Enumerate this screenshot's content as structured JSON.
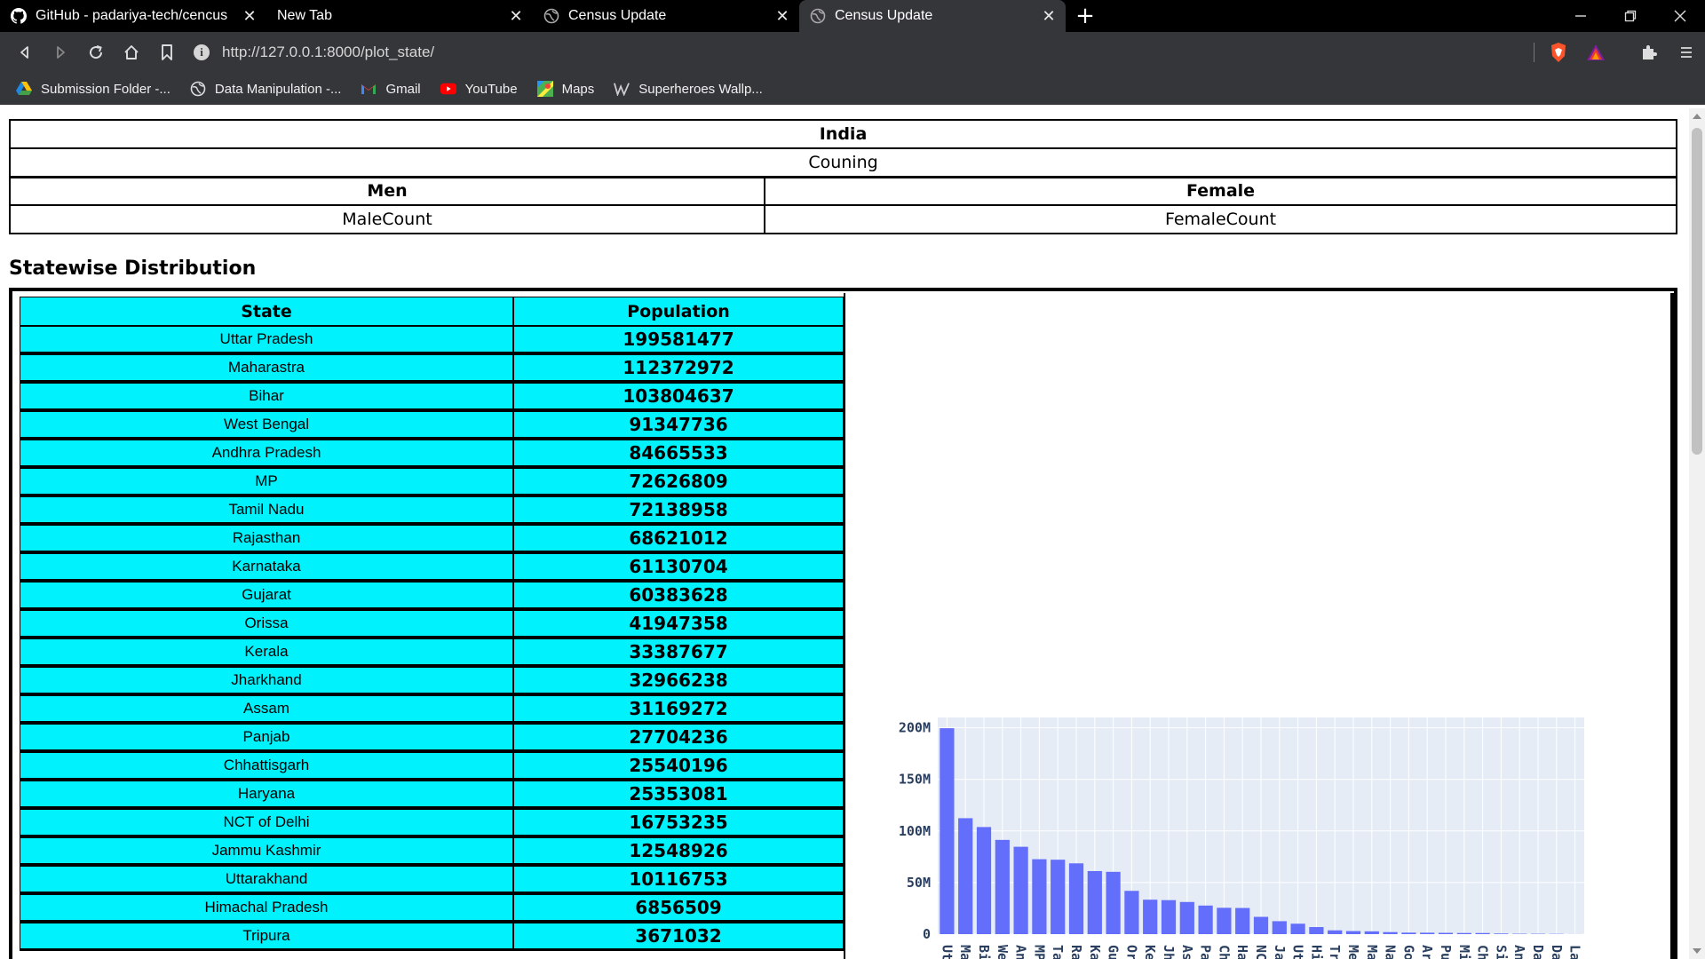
{
  "browser": {
    "tabs": [
      {
        "title": "GitHub - padariya-tech/cencus",
        "icon": "github-icon",
        "active": false
      },
      {
        "title": "New Tab",
        "icon": "none",
        "active": false
      },
      {
        "title": "Census Update",
        "icon": "globe-icon",
        "active": false
      },
      {
        "title": "Census Update",
        "icon": "globe-icon",
        "active": true
      }
    ],
    "url": "http://127.0.0.1:8000/plot_state/",
    "bookmarks": [
      {
        "label": "Submission Folder -...",
        "icon": "drive-icon"
      },
      {
        "label": "Data Manipulation -...",
        "icon": "globe-icon"
      },
      {
        "label": "Gmail",
        "icon": "gmail-icon"
      },
      {
        "label": "YouTube",
        "icon": "youtube-icon"
      },
      {
        "label": "Maps",
        "icon": "maps-icon"
      },
      {
        "label": "Superheroes Wallp...",
        "icon": "w-icon"
      }
    ]
  },
  "summary": {
    "country": "India",
    "counting": "Couning",
    "men_label": "Men",
    "female_label": "Female",
    "male_count": "MaleCount",
    "female_count": "FemaleCount"
  },
  "section_title": "Statewise Distribution",
  "table": {
    "headers": {
      "state": "State",
      "population": "Population"
    },
    "rows": [
      {
        "state": "Uttar Pradesh",
        "population": "199581477"
      },
      {
        "state": "Maharastra",
        "population": "112372972"
      },
      {
        "state": "Bihar",
        "population": "103804637"
      },
      {
        "state": "West Bengal",
        "population": "91347736"
      },
      {
        "state": "Andhra Pradesh",
        "population": "84665533"
      },
      {
        "state": "MP",
        "population": "72626809"
      },
      {
        "state": "Tamil Nadu",
        "population": "72138958"
      },
      {
        "state": "Rajasthan",
        "population": "68621012"
      },
      {
        "state": "Karnataka",
        "population": "61130704"
      },
      {
        "state": "Gujarat",
        "population": "60383628"
      },
      {
        "state": "Orissa",
        "population": "41947358"
      },
      {
        "state": "Kerala",
        "population": "33387677"
      },
      {
        "state": "Jharkhand",
        "population": "32966238"
      },
      {
        "state": "Assam",
        "population": "31169272"
      },
      {
        "state": "Panjab",
        "population": "27704236"
      },
      {
        "state": "Chhattisgarh",
        "population": "25540196"
      },
      {
        "state": "Haryana",
        "population": "25353081"
      },
      {
        "state": "NCT of Delhi",
        "population": "16753235"
      },
      {
        "state": "Jammu Kashmir",
        "population": "12548926"
      },
      {
        "state": "Uttarakhand",
        "population": "10116753"
      },
      {
        "state": "Himachal Pradesh",
        "population": "6856509"
      },
      {
        "state": "Tripura",
        "population": "3671032"
      }
    ]
  },
  "chart_data": {
    "type": "bar",
    "categories": [
      "Uttar P",
      "Mahara",
      "Bihar",
      "West B",
      "Andhra",
      "MP",
      "Tamil N",
      "Rajasth",
      "Karnat",
      "Gujara",
      "Orissa",
      "Kerala",
      "Jharkh",
      "Assam",
      "Panjab",
      "Chhatt",
      "Haryan",
      "NCT of",
      "Jammu",
      "Uttara",
      "Himach",
      "Tripura",
      "Megha",
      "Manipu",
      "Nagala",
      "Goa",
      "Arunac",
      "Puduch",
      "Mizora",
      "Chandi",
      "Sikkim",
      "Andam",
      "Dadra",
      "Daman",
      "Laksha"
    ],
    "values": [
      199581477,
      112372972,
      103804637,
      91347736,
      84665533,
      72626809,
      72138958,
      68621012,
      61130704,
      60383628,
      41947358,
      33387677,
      32966238,
      31169272,
      27704236,
      25540196,
      25353081,
      16753235,
      12548926,
      10116753,
      6856509,
      3671032,
      2964007,
      2721756,
      1980602,
      1457723,
      1382611,
      1244464,
      1091014,
      1054686,
      607688,
      379944,
      342853,
      242911,
      64429
    ],
    "ytick_labels": [
      "0",
      "50M",
      "100M",
      "150M",
      "200M"
    ],
    "ylim": [
      0,
      210000000
    ],
    "bar_color": "#636efa",
    "plot_bg": "#e5ecf6",
    "grid": true
  }
}
